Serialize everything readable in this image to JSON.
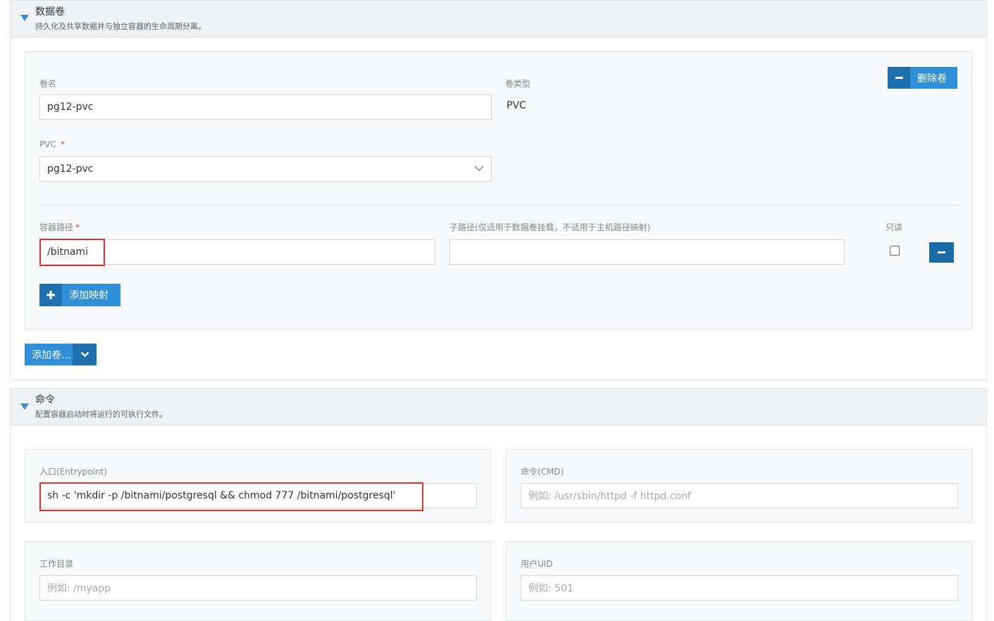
{
  "volumes_section": {
    "title": "数据卷",
    "description": "持久化及共享数据并与独立容器的生命周期分离。",
    "volume": {
      "name_label": "卷名",
      "name_value": "pg12-pvc",
      "type_label": "卷类型",
      "type_value": "PVC",
      "delete_label": "删除卷",
      "pvc_label": "PVC",
      "pvc_required": "*",
      "pvc_selected": "pg12-pvc",
      "mount": {
        "path_label": "容器路径",
        "path_required": "*",
        "path_value": "/bitnami",
        "subpath_label": "子路径(仅适用于数据卷挂载，不适用于主机路径映射)",
        "subpath_value": "",
        "readonly_label": "只读"
      },
      "add_mapping_label": "添加映射"
    },
    "add_volume_label": "添加卷..."
  },
  "command_section": {
    "title": "命令",
    "description": "配置容器启动时将运行的可执行文件。",
    "entrypoint_label": "入口(Entrypoint)",
    "entrypoint_value": "sh -c 'mkdir -p /bitnami/postgresql && chmod 777 /bitnami/postgresql'",
    "cmd_label": "命令(CMD)",
    "cmd_placeholder": "例如: /usr/sbin/httpd -f httpd.conf",
    "workdir_label": "工作目录",
    "workdir_placeholder": "例如: /myapp",
    "uid_label": "用户UID",
    "uid_placeholder": "例如: 501"
  },
  "colors": {
    "primary": "#1f7cc1",
    "primary_dark": "#1a6aa5",
    "highlight_red": "#e0322e",
    "header_bg": "#eef2f4"
  },
  "icons": [
    "triangle-down-icon",
    "minus-icon",
    "plus-icon",
    "chevron-down-icon"
  ]
}
